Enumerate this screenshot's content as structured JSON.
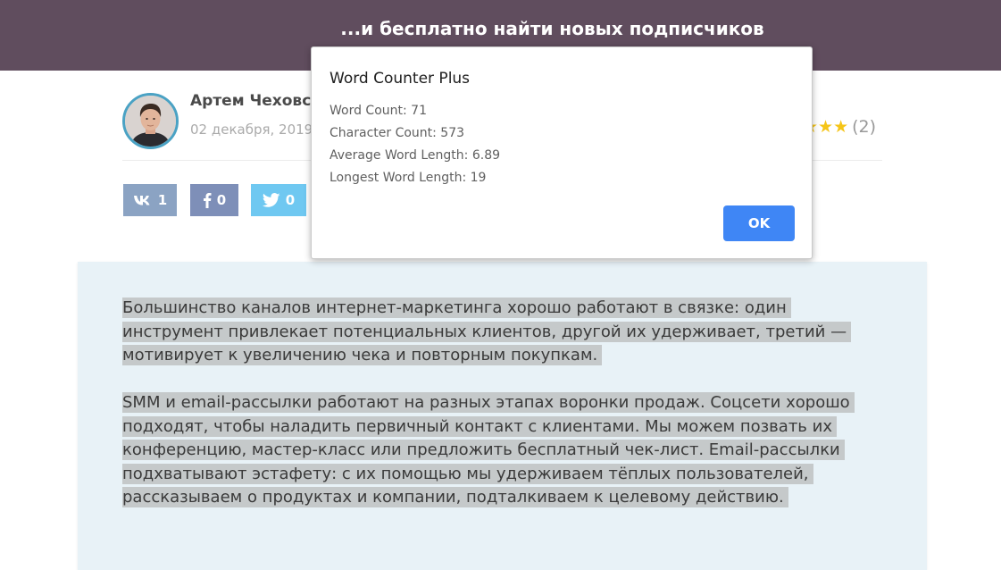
{
  "banner": {
    "title": "...и бесплатно найти новых подписчиков"
  },
  "author": {
    "name": "Артем Чеховск",
    "date": "02 декабря, 2019"
  },
  "rating": {
    "stars": "★★★",
    "count": "(2)"
  },
  "share": {
    "vk": {
      "icon": "vk-icon",
      "count": "1"
    },
    "facebook": {
      "icon": "facebook-icon",
      "count": "0"
    },
    "twitter": {
      "icon": "twitter-icon",
      "count": "0"
    }
  },
  "article": {
    "paragraph1": "Большинство каналов интернет-маркетинга хорошо работают в связке: один инструмент привлекает потенциальных клиентов, другой их удерживает, третий — мотивирует к увеличению чека и повторным покупкам.",
    "paragraph2": "SMM и email-рассылки работают на разных этапах воронки продаж. Соцсети хорошо подходят, чтобы наладить первичный контакт с клиентами. Мы можем позвать их конференцию, мастер-класс или предложить бесплатный чек-лист. Email-рассылки подхватывают эстафету: с их помощью мы удерживаем тёплых пользователей, рассказываем о продуктах и компании, подталкиваем к целевому действию."
  },
  "dialog": {
    "title": "Word Counter Plus",
    "word_count": "Word Count: 71",
    "char_count": "Character Count: 573",
    "avg_word_length": "Average Word Length: 6.89",
    "longest_word_length": "Longest Word Length: 19",
    "ok_label": "OK"
  },
  "colors": {
    "banner": "#604d5e",
    "quote_background": "#e8f2f7",
    "selection": "#c5c9ca",
    "ok_button": "#3f86f5",
    "star": "#f5c518",
    "vk": "#8ba3c3",
    "facebook": "#7e8fb8",
    "twitter": "#6fc8f1"
  }
}
